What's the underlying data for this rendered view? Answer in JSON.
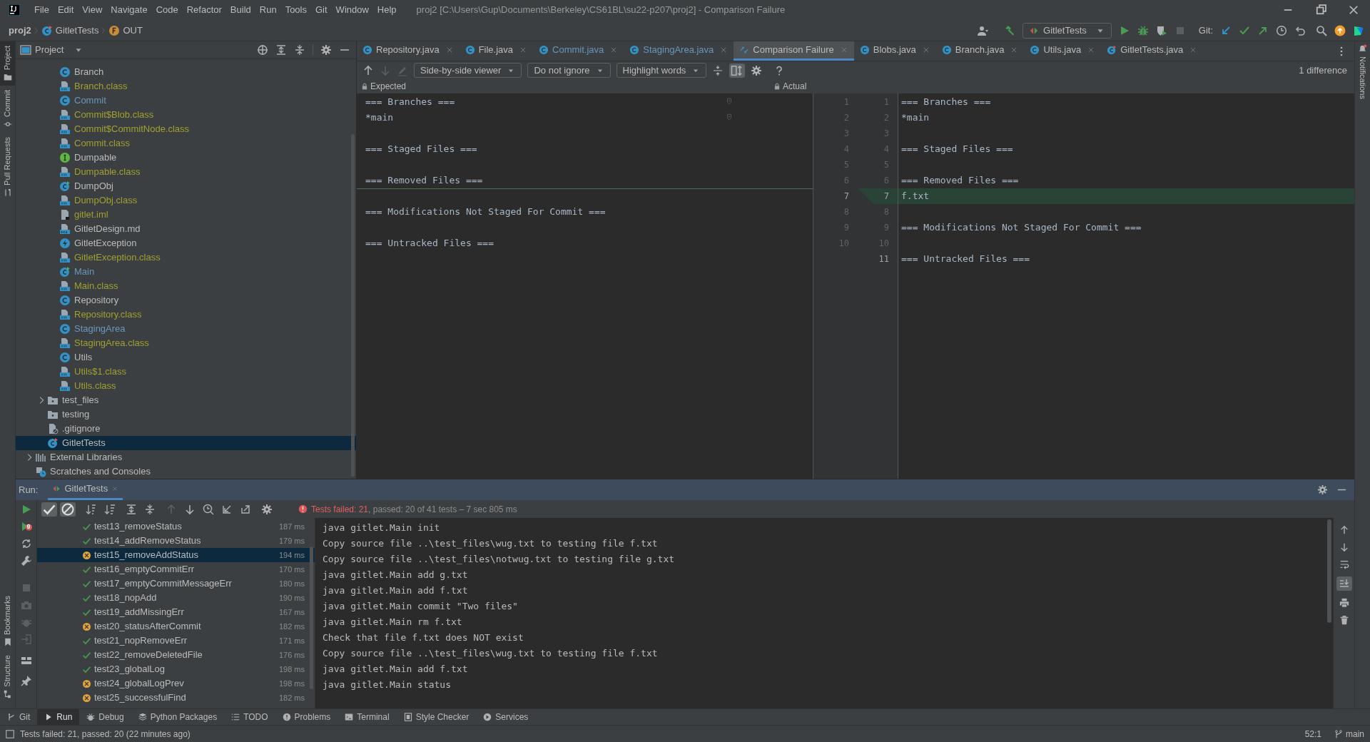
{
  "menu": [
    "File",
    "Edit",
    "View",
    "Navigate",
    "Code",
    "Refactor",
    "Build",
    "Run",
    "Tools",
    "Git",
    "Window",
    "Help"
  ],
  "window": {
    "title": "proj2 [C:\\Users\\Gup\\Documents\\Berkeley\\CS61BL\\su22-p207\\proj2] - Comparison Failure"
  },
  "breadcrumbs": [
    {
      "label": "proj2",
      "kind": "project"
    },
    {
      "label": "GitletTests",
      "kind": "test"
    },
    {
      "label": "OUT",
      "kind": "field"
    }
  ],
  "run_config": "GitletTests",
  "git_label": "Git:",
  "left_strip": {
    "top": [
      {
        "label": "Project",
        "selected": true
      },
      {
        "label": "Commit",
        "selected": false
      },
      {
        "label": "Pull Requests",
        "selected": false
      }
    ],
    "bottom": [
      {
        "label": "Bookmarks"
      },
      {
        "label": "Structure"
      }
    ]
  },
  "right_strip": [
    "Notifications"
  ],
  "project": {
    "title": "Project",
    "tree": [
      {
        "children": [
          {
            "children": [
              {
                "label": "Branch",
                "kind": "class",
                "ignored": false,
                "modified": false
              },
              {
                "label": "Branch.class",
                "kind": "classfile",
                "ignored": true,
                "modified": false
              },
              {
                "label": "Commit",
                "kind": "class",
                "ignored": false,
                "modified": true
              },
              {
                "label": "Commit$Blob.class",
                "kind": "classfile",
                "ignored": true,
                "modified": false
              },
              {
                "label": "Commit$CommitNode.class",
                "kind": "classfile",
                "ignored": true,
                "modified": false
              },
              {
                "label": "Commit.class",
                "kind": "classfile",
                "ignored": true,
                "modified": false
              },
              {
                "label": "Dumpable",
                "kind": "interface",
                "ignored": false,
                "modified": false
              },
              {
                "label": "Dumpable.class",
                "kind": "classfile",
                "ignored": true,
                "modified": false
              },
              {
                "label": "DumpObj",
                "kind": "runnable",
                "ignored": false,
                "modified": false
              },
              {
                "label": "DumpObj.class",
                "kind": "classfile",
                "ignored": true,
                "modified": false
              },
              {
                "label": "gitlet.iml",
                "kind": "iml",
                "ignored": true,
                "modified": false
              },
              {
                "label": "GitletDesign.md",
                "kind": "markdown",
                "ignored": false,
                "modified": false
              },
              {
                "label": "GitletException",
                "kind": "exception",
                "ignored": false,
                "modified": false
              },
              {
                "label": "GitletException.class",
                "kind": "classfile",
                "ignored": true,
                "modified": false
              },
              {
                "label": "Main",
                "kind": "runnable",
                "ignored": false,
                "modified": true
              },
              {
                "label": "Main.class",
                "kind": "classfile",
                "ignored": true,
                "modified": false
              },
              {
                "label": "Repository",
                "kind": "class",
                "ignored": false,
                "modified": false
              },
              {
                "label": "Repository.class",
                "kind": "classfile",
                "ignored": true,
                "modified": false
              },
              {
                "label": "StagingArea",
                "kind": "class",
                "ignored": false,
                "modified": true
              },
              {
                "label": "StagingArea.class",
                "kind": "classfile",
                "ignored": true,
                "modified": false
              },
              {
                "label": "Utils",
                "kind": "class",
                "ignored": false,
                "modified": false
              },
              {
                "label": "Utils$1.class",
                "kind": "classfile",
                "ignored": true,
                "modified": false
              },
              {
                "label": "Utils.class",
                "kind": "classfile",
                "ignored": true,
                "modified": false
              }
            ]
          },
          {
            "label": "test_files",
            "kind": "folder",
            "expanded": false
          },
          {
            "label": "testing",
            "kind": "folder"
          },
          {
            "label": ".gitignore",
            "kind": "gitignore"
          },
          {
            "label": "GitletTests",
            "kind": "test",
            "selected": true
          }
        ]
      },
      {
        "label": "External Libraries",
        "kind": "libraries",
        "expanded": false
      },
      {
        "label": "Scratches and Consoles",
        "kind": "scratches"
      }
    ]
  },
  "tabs": [
    {
      "label": "Repository.java",
      "kind": "class",
      "modified": false,
      "selected": false
    },
    {
      "label": "File.java",
      "kind": "class",
      "modified": false,
      "selected": false
    },
    {
      "label": "Commit.java",
      "kind": "class",
      "modified": true,
      "selected": false
    },
    {
      "label": "StagingArea.java",
      "kind": "class",
      "modified": true,
      "selected": false
    },
    {
      "label": "Comparison Failure",
      "kind": "diff",
      "modified": false,
      "selected": true
    },
    {
      "label": "Blobs.java",
      "kind": "class",
      "modified": false,
      "selected": false
    },
    {
      "label": "Branch.java",
      "kind": "class",
      "modified": false,
      "selected": false
    },
    {
      "label": "Utils.java",
      "kind": "class",
      "modified": false,
      "selected": false
    },
    {
      "label": "GitletTests.java",
      "kind": "test",
      "modified": false,
      "selected": false
    }
  ],
  "diff_toolbar": {
    "viewer": "Side-by-side viewer",
    "ignore": "Do not ignore",
    "highlight": "Highlight words",
    "differences": "1 difference"
  },
  "diff": {
    "left_title": "Expected",
    "right_title": "Actual",
    "left": [
      {
        "number": "1",
        "text": "=== Branches ===",
        "current": false
      },
      {
        "number": "2",
        "text": "*main",
        "current": false
      },
      {
        "number": "3",
        "current": false
      },
      {
        "number": "4",
        "text": "=== Staged Files ===",
        "current": false
      },
      {
        "number": "5",
        "current": false
      },
      {
        "number": "6",
        "text": "=== Removed Files ===",
        "current": false
      },
      {
        "number": "7",
        "current": true
      },
      {
        "number": "8",
        "text": "=== Modifications Not Staged For Commit ===",
        "current": false
      },
      {
        "number": "9",
        "current": false
      },
      {
        "number": "10",
        "text": "=== Untracked Files ===",
        "current": false
      }
    ],
    "right": [
      {
        "number": "1",
        "text": "=== Branches ===",
        "current": false,
        "inserted": false
      },
      {
        "number": "2",
        "text": "*main",
        "current": false,
        "inserted": false
      },
      {
        "number": "3",
        "current": false,
        "inserted": false
      },
      {
        "number": "4",
        "text": "=== Staged Files ===",
        "current": false,
        "inserted": false
      },
      {
        "number": "5",
        "current": false,
        "inserted": false
      },
      {
        "number": "6",
        "text": "=== Removed Files ===",
        "current": false,
        "inserted": false
      },
      {
        "number": "7",
        "text": "f.txt",
        "current": true,
        "inserted": true
      },
      {
        "number": "8",
        "current": false,
        "inserted": false
      },
      {
        "number": "9",
        "text": "=== Modifications Not Staged For Commit ===",
        "current": false,
        "inserted": false
      },
      {
        "number": "10",
        "current": false,
        "inserted": false
      },
      {
        "number": "11",
        "text": "=== Untracked Files ===",
        "current": true,
        "inserted": false
      }
    ]
  },
  "run": {
    "label": "Run:",
    "tab": "GitletTests",
    "fail_count": "9",
    "summary_failed": "Tests failed: 21",
    "summary_rest": ", passed: 20 of 41 tests – 7 sec 805 ms",
    "tests": [
      {
        "name": "test13_removeStatus",
        "time": "187 ms",
        "passed": true,
        "selected": false
      },
      {
        "name": "test14_addRemoveStatus",
        "time": "179 ms",
        "passed": true,
        "selected": false
      },
      {
        "name": "test15_removeAddStatus",
        "time": "194 ms",
        "passed": false,
        "selected": true
      },
      {
        "name": "test16_emptyCommitErr",
        "time": "170 ms",
        "passed": true,
        "selected": false
      },
      {
        "name": "test17_emptyCommitMessageErr",
        "time": "180 ms",
        "passed": true,
        "selected": false
      },
      {
        "name": "test18_nopAdd",
        "time": "190 ms",
        "passed": true,
        "selected": false
      },
      {
        "name": "test19_addMissingErr",
        "time": "167 ms",
        "passed": true,
        "selected": false
      },
      {
        "name": "test20_statusAfterCommit",
        "time": "182 ms",
        "passed": false,
        "selected": false
      },
      {
        "name": "test21_nopRemoveErr",
        "time": "171 ms",
        "passed": true,
        "selected": false
      },
      {
        "name": "test22_removeDeletedFile",
        "time": "176 ms",
        "passed": true,
        "selected": false
      },
      {
        "name": "test23_globalLog",
        "time": "198 ms",
        "passed": true,
        "selected": false
      },
      {
        "name": "test24_globalLogPrev",
        "time": "198 ms",
        "passed": false,
        "selected": false
      },
      {
        "name": "test25_successfulFind",
        "time": "182 ms",
        "passed": false,
        "selected": false
      }
    ],
    "console": [
      "java gitlet.Main init",
      "Copy source file ..\\test_files\\wug.txt to testing file f.txt",
      "Copy source file ..\\test_files\\notwug.txt to testing file g.txt",
      "java gitlet.Main add g.txt",
      "java gitlet.Main add f.txt",
      "java gitlet.Main commit \"Two files\"",
      "java gitlet.Main rm f.txt",
      "Check that file f.txt does NOT exist",
      "Copy source file ..\\test_files\\wug.txt to testing file f.txt",
      "java gitlet.Main add f.txt",
      "java gitlet.Main status"
    ]
  },
  "tool_tabs": [
    {
      "label": "Git",
      "kind": "git",
      "selected": false
    },
    {
      "label": "Run",
      "kind": "run",
      "selected": true
    },
    {
      "label": "Debug",
      "kind": "debug",
      "selected": false
    },
    {
      "label": "Python Packages",
      "kind": "packages",
      "selected": false
    },
    {
      "label": "TODO",
      "kind": "todo",
      "selected": false
    },
    {
      "label": "Problems",
      "kind": "problems",
      "selected": false
    },
    {
      "label": "Terminal",
      "kind": "terminal",
      "selected": false
    },
    {
      "label": "Style Checker",
      "kind": "checker",
      "selected": false
    },
    {
      "label": "Services",
      "kind": "services",
      "selected": false
    }
  ],
  "status_bar": {
    "message": "Tests failed: 21, passed: 20 (22 minutes ago)",
    "position": "52:1",
    "branch": "main"
  }
}
